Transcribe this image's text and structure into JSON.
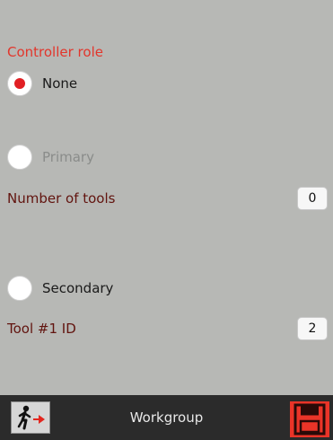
{
  "controller_role": {
    "title": "Controller role",
    "options": [
      {
        "label": "None",
        "selected": true,
        "enabled": true
      },
      {
        "label": "Primary",
        "selected": false,
        "enabled": false
      },
      {
        "label": "Secondary",
        "selected": false,
        "enabled": true
      }
    ]
  },
  "fields": {
    "number_of_tools": {
      "label": "Number of tools",
      "value": "0"
    },
    "tool_1_id": {
      "label": "Tool #1 ID",
      "value": "2"
    }
  },
  "bottom_bar": {
    "title": "Workgroup",
    "exit_icon": "exit-door-icon",
    "save_icon": "floppy-save-icon"
  },
  "colors": {
    "background": "#b7b8b5",
    "section_title": "#e2362c",
    "field_label": "#62140f",
    "radio_selected": "#e11f23",
    "bar": "#2b2b2b",
    "save_button": "#ea3428"
  }
}
